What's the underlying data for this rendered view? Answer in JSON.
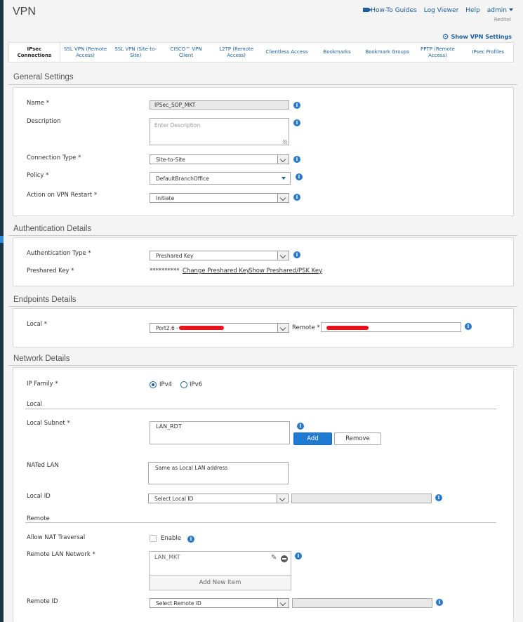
{
  "header": {
    "title": "VPN",
    "links": {
      "how_to": "How-To Guides",
      "log_viewer": "Log Viewer",
      "help": "Help",
      "user": "admin"
    },
    "org": "Reditel",
    "show_settings": "Show VPN Settings"
  },
  "tabs": [
    "IPsec Connections",
    "SSL VPN (Remote Access)",
    "SSL VPN (Site-to-Site)",
    "CISCO™ VPN Client",
    "L2TP (Remote Access)",
    "Clientless Access",
    "Bookmarks",
    "Bookmark Groups",
    "PPTP (Remote Access)",
    "IPsec Profiles"
  ],
  "general": {
    "title": "General Settings",
    "name_label": "Name *",
    "name_value": "IPSec_SOP_MKT",
    "desc_label": "Description",
    "desc_placeholder": "Enter Description",
    "conn_type_label": "Connection Type *",
    "conn_type_value": "Site-to-Site",
    "policy_label": "Policy *",
    "policy_value": "DefaultBranchOffice",
    "action_label": "Action on VPN Restart *",
    "action_value": "Initiate"
  },
  "auth": {
    "title": "Authentication Details",
    "type_label": "Authentication Type *",
    "type_value": "Preshared Key",
    "key_label": "Preshared Key *",
    "key_mask": "**********",
    "change_link": "Change Preshared Key",
    "show_link": "Show Preshared/PSK Key"
  },
  "endpoints": {
    "title": "Endpoints Details",
    "local_label": "Local *",
    "local_value": "Port2.6 -",
    "remote_label": "Remote *"
  },
  "network": {
    "title": "Network Details",
    "ip_family_label": "IP Family *",
    "ipv4": "IPv4",
    "ipv6": "IPv6",
    "local_heading": "Local",
    "local_subnet_label": "Local Subnet *",
    "local_subnet_item": "LAN_RDT",
    "add_btn": "Add",
    "remove_btn": "Remove",
    "nated_label": "NATed LAN",
    "nated_value": "Same as Local LAN address",
    "local_id_label": "Local ID",
    "local_id_value": "Select Local ID",
    "remote_heading": "Remote",
    "nat_trav_label": "Allow NAT Traversal",
    "enable_label": "Enable",
    "remote_lan_label": "Remote LAN Network *",
    "remote_lan_item": "LAN_MKT",
    "add_new_item": "Add New Item",
    "remote_id_label": "Remote ID",
    "remote_id_value": "Select Remote ID"
  }
}
